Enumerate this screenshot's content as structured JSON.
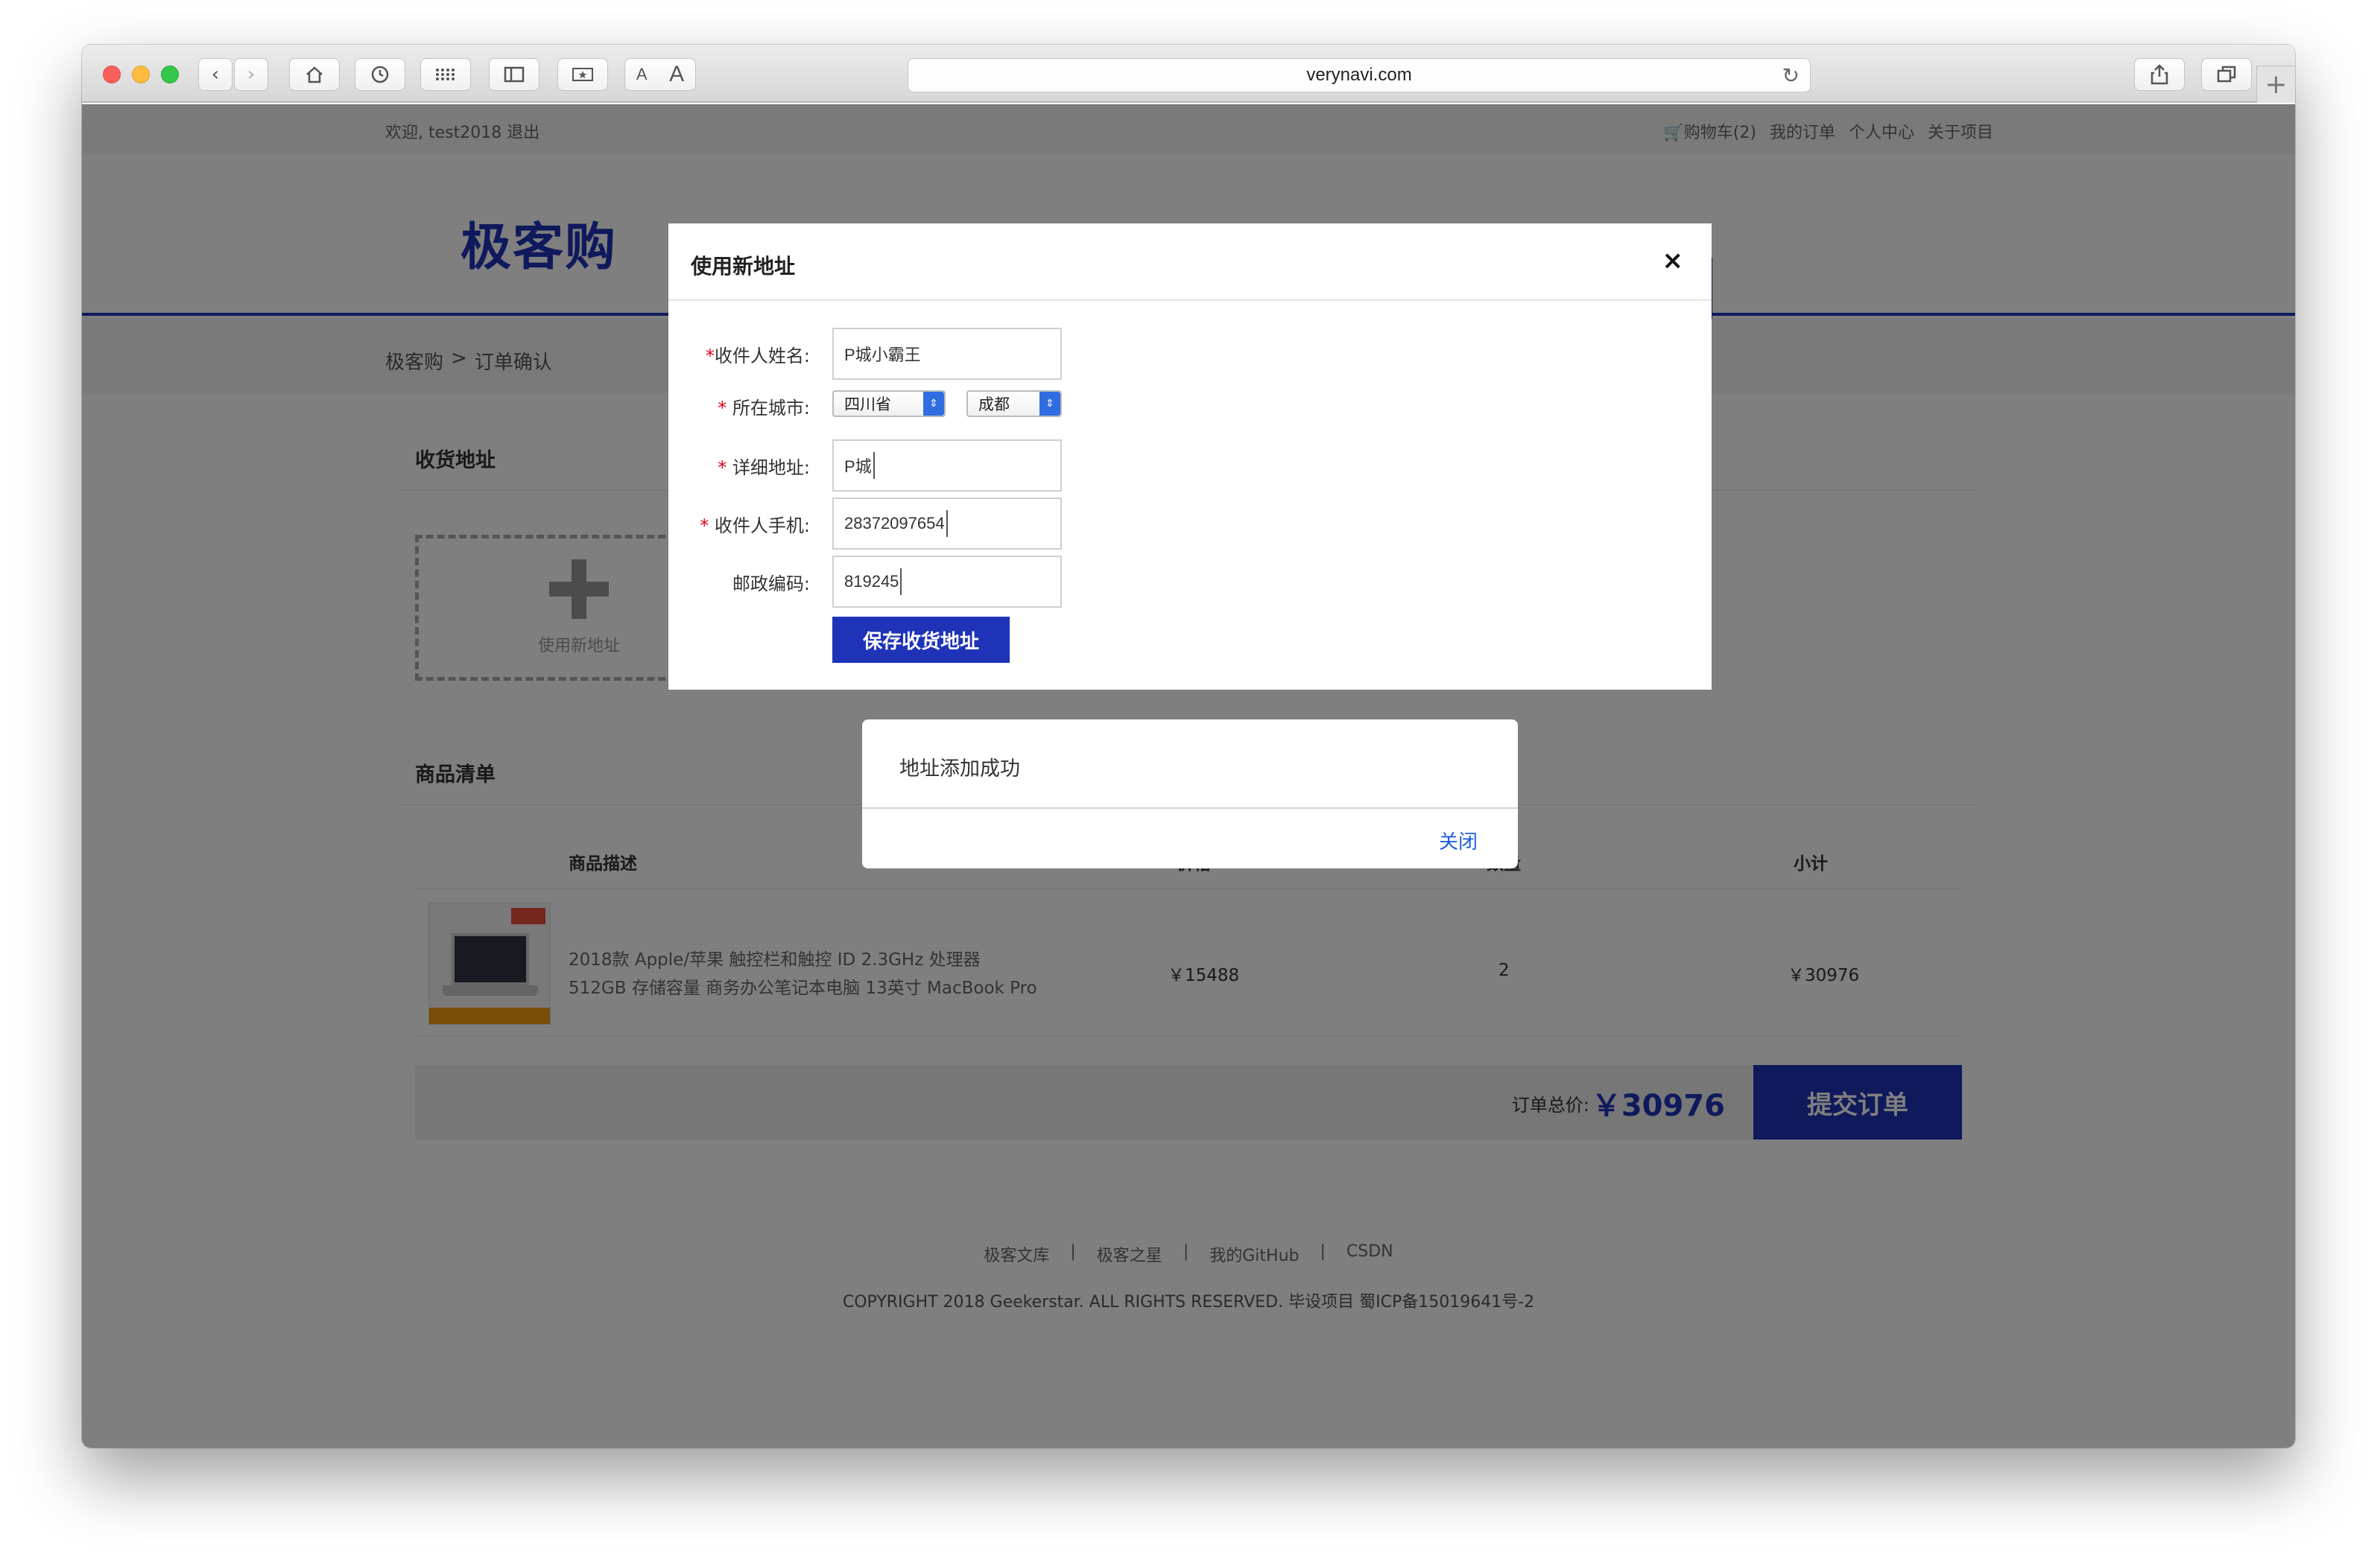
{
  "browser": {
    "url": "verynavi.com",
    "font_small": "A",
    "font_large": "A"
  },
  "site": {
    "welcome": "欢迎, test2018 退出",
    "top_links": [
      "购物车(2)",
      "我的订单",
      "个人中心",
      "关于项目"
    ],
    "logo": "极客购",
    "breadcrumb": [
      "极客购",
      ">",
      "订单确认"
    ],
    "accent_color": "#1e33b8"
  },
  "address_section": {
    "title": "收货地址",
    "add_new_label": "使用新地址"
  },
  "goods_section": {
    "title": "商品清单",
    "columns": [
      "商品描述",
      "价格",
      "数量",
      "小计"
    ],
    "rows": [
      {
        "description_line1": "2018款 Apple/苹果 触控栏和触控 ID 2.3GHz 处理器",
        "description_line2": "512GB 存储容量 商务办公笔记本电脑 13英寸 MacBook Pro",
        "price": "￥15488",
        "quantity": "2",
        "subtotal": "￥30976"
      }
    ],
    "total_label": "订单总价:",
    "total_value": "￥30976",
    "submit_label": "提交订单"
  },
  "footer": {
    "links": [
      "极客文库",
      "|",
      "极客之星",
      "|",
      "我的GitHub",
      "|",
      "CSDN"
    ],
    "copyright": "COPYRIGHT 2018 Geekerstar. ALL RIGHTS RESERVED. 毕设项目 蜀ICP备15019641号-2"
  },
  "address_modal": {
    "title": "使用新地址",
    "close_icon": "×",
    "fields": {
      "name_label": "收件人姓名:",
      "name_value": "P城小霸王",
      "city_label": "所在城市:",
      "province_value": "四川省",
      "city_value": "成都",
      "detail_label": "详细地址:",
      "detail_value": "P城",
      "phone_label": "收件人手机:",
      "phone_value": "28372097654",
      "zip_label": "邮政编码:",
      "zip_value": "819245"
    },
    "required_mark": "*",
    "save_label": "保存收货地址"
  },
  "alert": {
    "message": "地址添加成功",
    "close_label": "关闭"
  }
}
